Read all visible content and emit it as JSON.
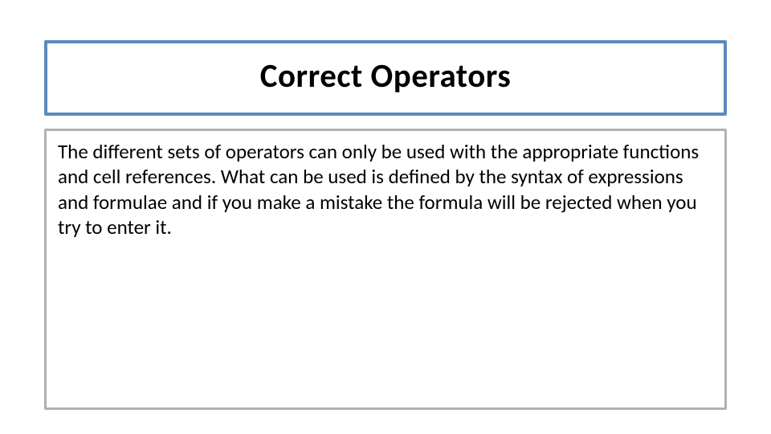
{
  "slide": {
    "title": "Correct Operators",
    "body": "The different sets of operators can only be used with the appropriate functions and cell references. What can be used is defined by the syntax of expressions and formulae and if you make a mistake the formula will be rejected when you try to enter it."
  }
}
